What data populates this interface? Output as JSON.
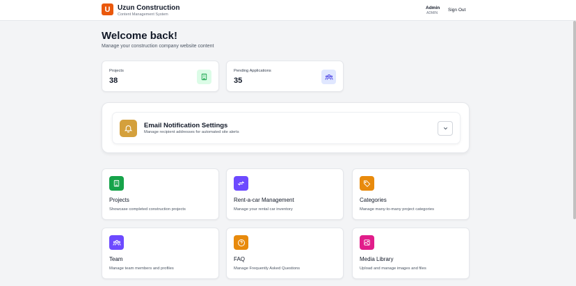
{
  "header": {
    "logo_letter": "U",
    "brand_title": "Uzun Construction",
    "brand_subtitle": "Content Management System",
    "user_name": "Admin",
    "user_role": "ADMIN",
    "signout_label": "Sign Out"
  },
  "welcome": {
    "title": "Welcome back!",
    "subtitle": "Manage your construction company website content"
  },
  "stats": [
    {
      "label": "Projects",
      "value": "38",
      "icon": "building-icon",
      "icon_bg": "#dcfce7",
      "icon_color": "#16a34a"
    },
    {
      "label": "Pending Applications",
      "value": "35",
      "icon": "users-icon",
      "icon_bg": "#e0e7ff",
      "icon_color": "#4f46e5"
    }
  ],
  "email_settings": {
    "title": "Email Notification Settings",
    "subtitle": "Manage recipient addresses for automated site alerts",
    "icon": "bell-icon",
    "icon_bg": "#d4a03c"
  },
  "cards": [
    {
      "title": "Projects",
      "desc": "Showcase completed construction projects",
      "icon": "building-icon",
      "icon_bg": "#16a34a"
    },
    {
      "title": "Rent-a-car Management",
      "desc": "Manage your rental car inventory",
      "icon": "swap-icon",
      "icon_bg": "#6d4aff"
    },
    {
      "title": "Categories",
      "desc": "Manage many-to-many project categories",
      "icon": "tag-icon",
      "icon_bg": "#e88a0c"
    },
    {
      "title": "Team",
      "desc": "Manage team members and profiles",
      "icon": "users-icon",
      "icon_bg": "#6d4aff"
    },
    {
      "title": "FAQ",
      "desc": "Manage Frequently Asked Questions",
      "icon": "help-icon",
      "icon_bg": "#e88a0c"
    },
    {
      "title": "Media Library",
      "desc": "Upload and manage images and files",
      "icon": "image-icon",
      "icon_bg": "#e11d8a"
    }
  ]
}
